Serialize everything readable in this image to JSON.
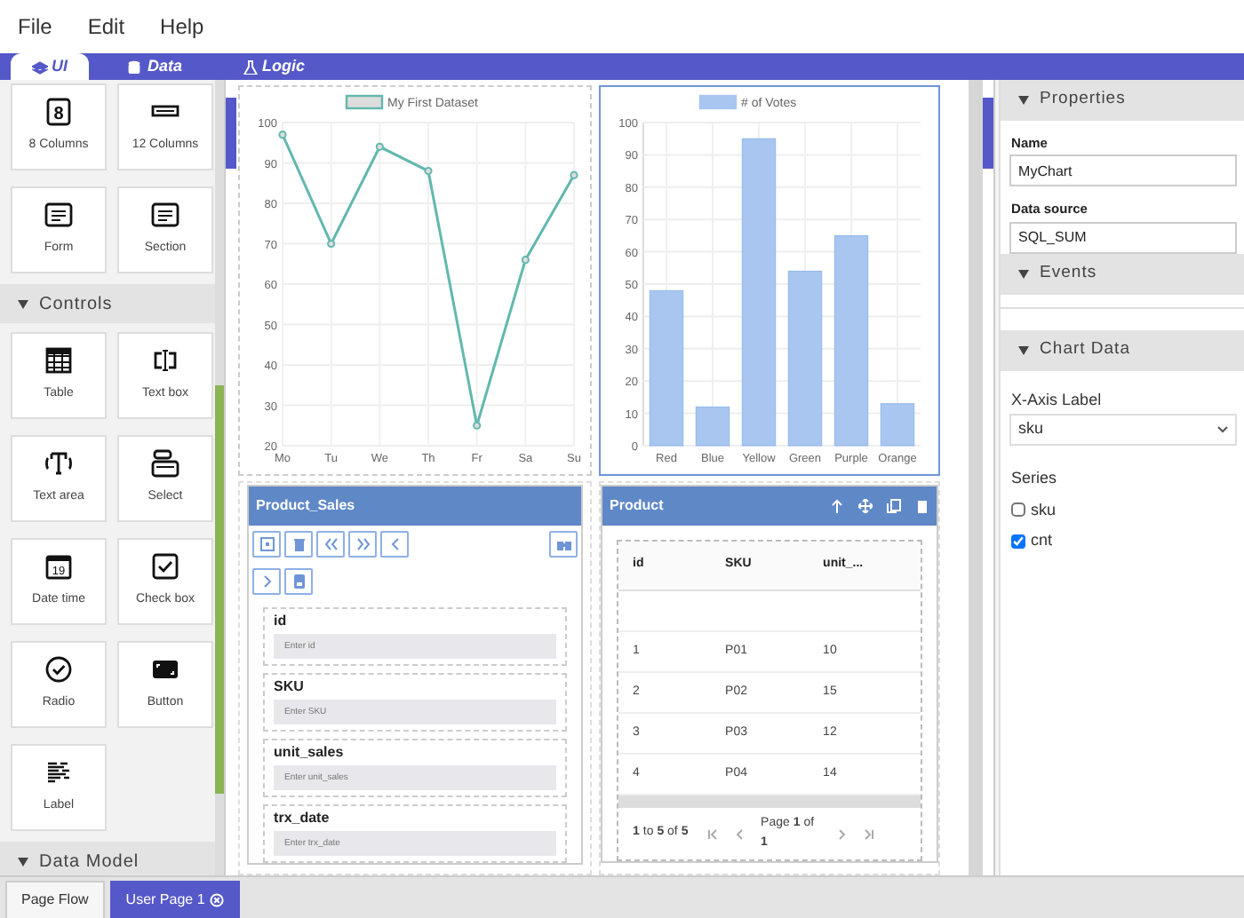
{
  "menu": [
    "File",
    "Edit",
    "Help"
  ],
  "top_tabs": [
    {
      "label": "UI",
      "selected": true
    },
    {
      "label": "Data",
      "selected": false
    },
    {
      "label": "Logic",
      "selected": false
    }
  ],
  "palette": {
    "items": [
      {
        "label": "8 Columns",
        "icon_text": "8"
      },
      {
        "label": "12 Columns"
      },
      {
        "label": "Form"
      },
      {
        "label": "Section"
      }
    ],
    "sections": [
      {
        "title": "Controls",
        "expanded": true,
        "items": [
          {
            "label": "Table"
          },
          {
            "label": "Text box"
          },
          {
            "label": "Text area"
          },
          {
            "label": "Select"
          },
          {
            "label": "Date time",
            "icon_text": "19"
          },
          {
            "label": "Check box"
          },
          {
            "label": "Radio"
          },
          {
            "label": "Button"
          },
          {
            "label": "Label"
          }
        ]
      },
      {
        "title": "Data Model",
        "expanded": true
      }
    ]
  },
  "charts": [
    {
      "selected": false,
      "chart_data": {
        "type": "line",
        "categories": [
          "Mo",
          "Tu",
          "We",
          "Th",
          "Fr",
          "Sa",
          "Su"
        ],
        "grid": true,
        "series": [
          {
            "name": "My First Dataset",
            "color": "#62b8ae",
            "marker": true,
            "values": [
              97,
              70,
              94,
              88,
              25,
              66,
              87
            ]
          }
        ],
        "ylim": [
          20,
          100
        ],
        "yticks": [
          20,
          30,
          40,
          50,
          60,
          70,
          80,
          90,
          100
        ]
      }
    },
    {
      "selected": true,
      "chart_data": {
        "type": "bar",
        "categories": [
          "Red",
          "Blue",
          "Yellow",
          "Green",
          "Purple",
          "Orange"
        ],
        "grid": true,
        "series": [
          {
            "name": "# of Votes",
            "color": "#a8c6ef",
            "values": [
              48,
              12,
              95,
              54,
              65,
              13
            ]
          }
        ],
        "ylim": [
          0,
          100
        ],
        "yticks": [
          0,
          10,
          20,
          30,
          40,
          50,
          60,
          70,
          80,
          90,
          100
        ]
      }
    }
  ],
  "form": {
    "title": "Product_Sales",
    "fields": [
      {
        "label": "id",
        "placeholder": "Enter id"
      },
      {
        "label": "SKU",
        "placeholder": "Enter SKU"
      },
      {
        "label": "unit_sales",
        "placeholder": "Enter unit_sales"
      },
      {
        "label": "trx_date",
        "placeholder": "Enter trx_date"
      }
    ]
  },
  "table": {
    "title": "Product",
    "columns": [
      "id",
      "SKU",
      "unit_..."
    ],
    "rows": [
      [
        "1",
        "P01",
        "10"
      ],
      [
        "2",
        "P02",
        "15"
      ],
      [
        "3",
        "P03",
        "12"
      ],
      [
        "4",
        "P04",
        "14"
      ]
    ],
    "range": "**1** to **5** of **5**",
    "page": "Page **1** of **1**"
  },
  "properties": {
    "sections": [
      {
        "title": "Properties",
        "expanded": true
      },
      {
        "title": "Events",
        "expanded": true
      },
      {
        "title": "Chart Data",
        "expanded": true
      }
    ],
    "fields": [
      {
        "label": "Name",
        "value": "MyChart"
      },
      {
        "label": "Data source",
        "value": "SQL_SUM"
      }
    ],
    "x_axis": {
      "label": "X-Axis Label",
      "value": "sku"
    },
    "series_label": "Series",
    "series": [
      {
        "label": "sku",
        "checked": false
      },
      {
        "label": "cnt",
        "checked": true
      }
    ]
  },
  "bottom_tabs": [
    {
      "label": "Page Flow",
      "selected": false,
      "closable": false
    },
    {
      "label": "User Page 1",
      "selected": true,
      "closable": true
    }
  ]
}
